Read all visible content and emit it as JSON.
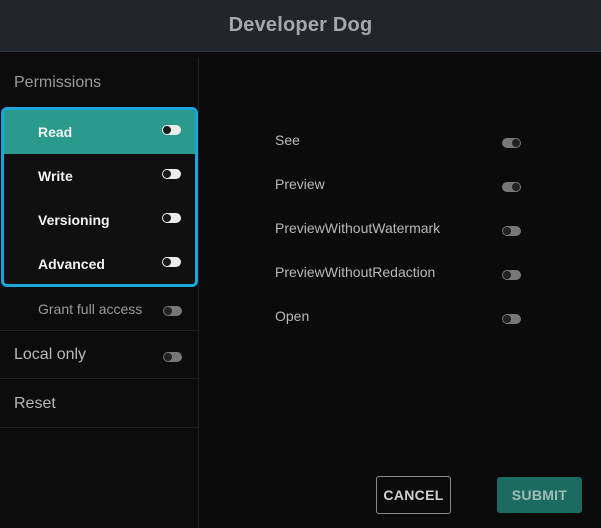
{
  "window": {
    "title": "Developer Dog"
  },
  "sidebar": {
    "section_title": "Permissions",
    "permissions": [
      {
        "label": "Read",
        "active": true,
        "toggle": "on"
      },
      {
        "label": "Write",
        "active": false,
        "toggle": "on"
      },
      {
        "label": "Versioning",
        "active": false,
        "toggle": "on"
      },
      {
        "label": "Advanced",
        "active": false,
        "toggle": "on"
      }
    ],
    "grant_full_access": {
      "label": "Grant full access",
      "toggle": "off"
    },
    "local_only": {
      "label": "Local only",
      "toggle": "off"
    },
    "reset": {
      "label": "Reset"
    }
  },
  "main": {
    "sub_permissions": [
      {
        "label": "See",
        "toggle": "on"
      },
      {
        "label": "Preview",
        "toggle": "on"
      },
      {
        "label": "PreviewWithoutWatermark",
        "toggle": "off"
      },
      {
        "label": "PreviewWithoutRedaction",
        "toggle": "off"
      },
      {
        "label": "Open",
        "toggle": "off"
      }
    ]
  },
  "buttons": {
    "cancel": "CANCEL",
    "submit": "SUBMIT"
  },
  "colors": {
    "accent_teal": "#2a9a8c",
    "highlight_border": "#1ba6db",
    "submit_bg": "#1c6b60",
    "titlebar_bg": "#22252b"
  }
}
